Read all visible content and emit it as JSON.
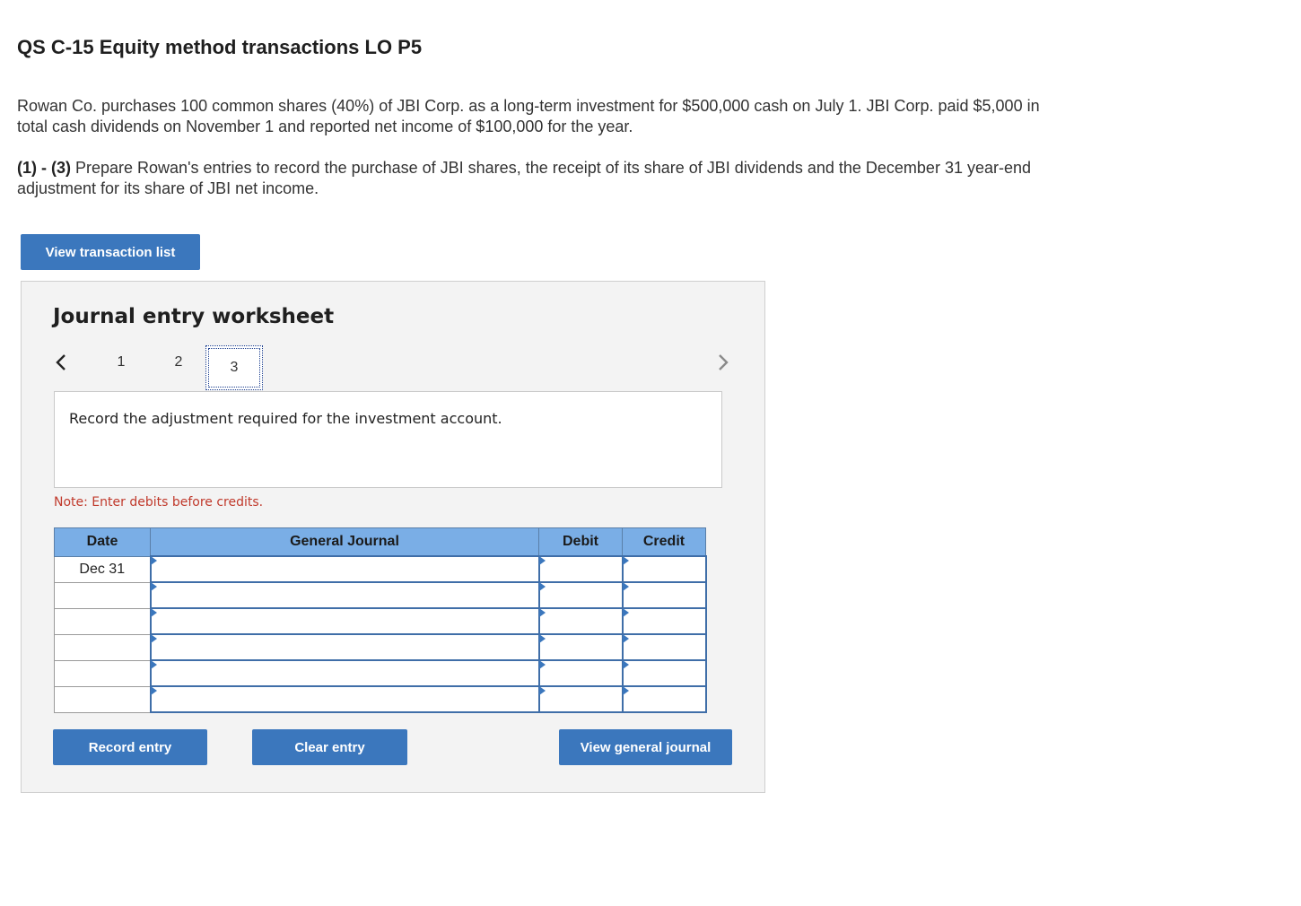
{
  "header": {
    "title": "QS C-15 Equity method transactions LO P5"
  },
  "problem": {
    "paragraph1": "Rowan Co. purchases 100 common shares (40%) of JBI Corp. as a long-term investment for $500,000 cash on July 1. JBI Corp. paid $5,000 in total cash dividends on November 1 and reported net income of $100,000 for the year.",
    "paragraph2_prefix": "(1) - (3)",
    "paragraph2": " Prepare Rowan's entries to record the purchase of JBI shares, the receipt of its share of JBI dividends and the December 31 year-end adjustment for its share of JBI net income."
  },
  "buttons": {
    "view_transaction_list": "View transaction list",
    "record_entry": "Record entry",
    "clear_entry": "Clear entry",
    "view_general_journal": "View general journal"
  },
  "worksheet": {
    "title": "Journal entry worksheet",
    "steps": [
      "1",
      "2",
      "3"
    ],
    "active_step": "3",
    "instruction": "Record the adjustment required for the investment account.",
    "note": "Note: Enter debits before credits."
  },
  "journal_table": {
    "headers": [
      "Date",
      "General Journal",
      "Debit",
      "Credit"
    ],
    "rows": [
      {
        "date": "Dec 31",
        "account": "",
        "debit": "",
        "credit": ""
      },
      {
        "date": "",
        "account": "",
        "debit": "",
        "credit": ""
      },
      {
        "date": "",
        "account": "",
        "debit": "",
        "credit": ""
      },
      {
        "date": "",
        "account": "",
        "debit": "",
        "credit": ""
      },
      {
        "date": "",
        "account": "",
        "debit": "",
        "credit": ""
      },
      {
        "date": "",
        "account": "",
        "debit": "",
        "credit": ""
      }
    ]
  },
  "colors": {
    "button_blue": "#3b77bd",
    "table_header": "#7aaee6",
    "note_red": "#c0392b"
  },
  "icons": {
    "prev": "chevron-left-icon",
    "next": "chevron-right-icon"
  }
}
